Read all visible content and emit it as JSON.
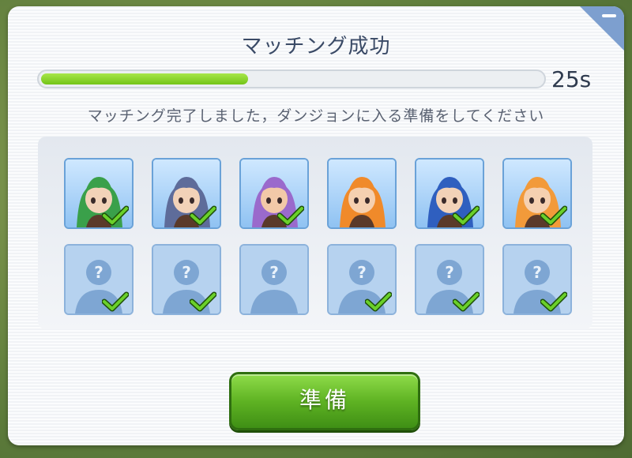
{
  "dialog": {
    "title": "マッチング成功",
    "timer": "25s",
    "progress": 0.41,
    "message": "マッチング完了しました，ダンジョンに入る準備をしてください",
    "ready_label": "準備",
    "minimize_icon": "minus-icon"
  },
  "party": [
    {
      "type": "character",
      "hair": "#3aa04a",
      "skin": "#f2d2b8",
      "ready": true
    },
    {
      "type": "character",
      "hair": "#5e6c9a",
      "skin": "#f2d2b8",
      "ready": true
    },
    {
      "type": "character",
      "hair": "#9a6acc",
      "skin": "#f2c9a8",
      "ready": true
    },
    {
      "type": "character",
      "hair": "#f08a2a",
      "skin": "#f5d0b0",
      "ready": false
    },
    {
      "type": "character",
      "hair": "#2f5fbf",
      "skin": "#f2d2b8",
      "ready": true
    },
    {
      "type": "character",
      "hair": "#f29a3a",
      "skin": "#f5d0b0",
      "ready": true
    },
    {
      "type": "unknown",
      "ready": true
    },
    {
      "type": "unknown",
      "ready": true
    },
    {
      "type": "unknown",
      "ready": false
    },
    {
      "type": "unknown",
      "ready": true
    },
    {
      "type": "unknown",
      "ready": true
    },
    {
      "type": "unknown",
      "ready": true
    }
  ],
  "colors": {
    "accent_green": "#5fb323",
    "check_green": "#5cc21c",
    "corner_blue": "#7d9fcf"
  }
}
